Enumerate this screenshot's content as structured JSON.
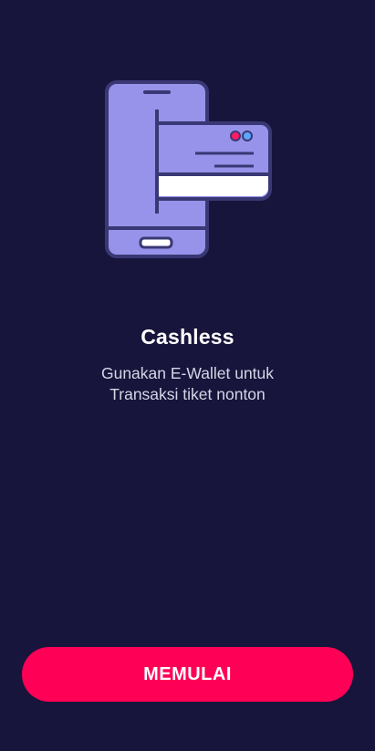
{
  "onboarding": {
    "illustration_icon": "phone-with-card-icon",
    "title": "Cashless",
    "subtitle_lines": [
      "Gunakan E-Wallet untuk",
      "Transaksi tiket nonton"
    ],
    "cta_label": "MEMULAI"
  },
  "colors": {
    "background": "#17153b",
    "accent": "#ff0057",
    "illustration_fill": "#9793ea",
    "illustration_stroke": "#3a3874"
  }
}
